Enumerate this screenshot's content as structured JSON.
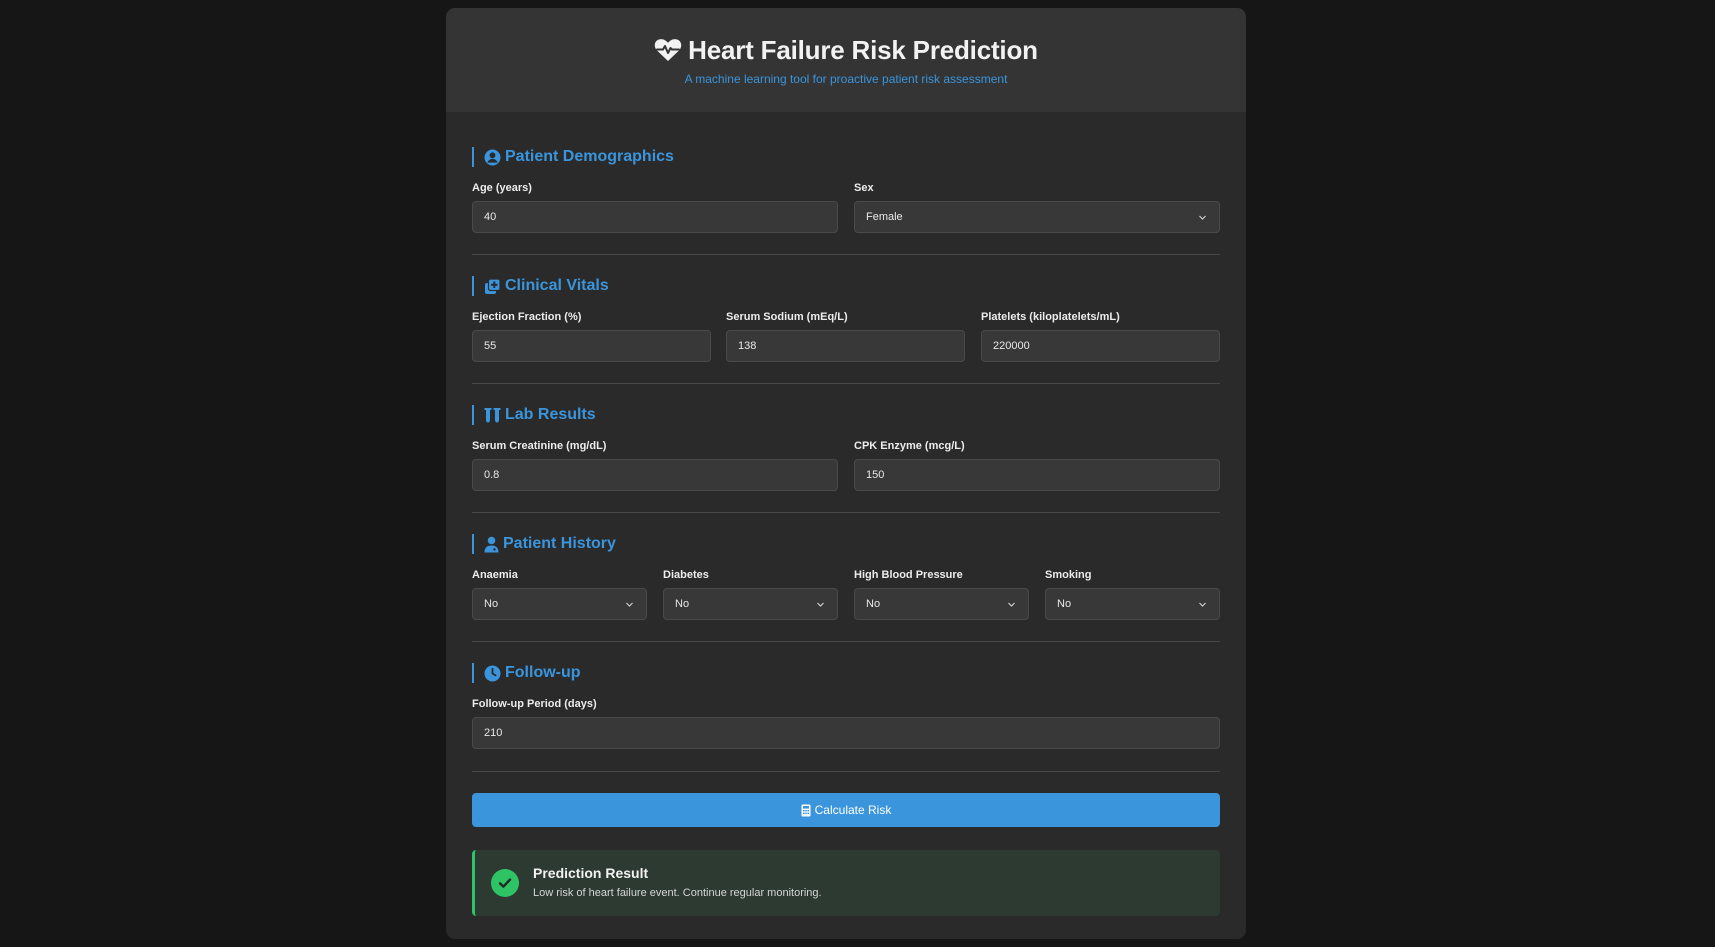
{
  "header": {
    "title": "Heart Failure Risk Prediction",
    "subtitle": "A machine learning tool for proactive patient risk assessment"
  },
  "sections": {
    "demographics": {
      "title": "Patient Demographics",
      "age_label": "Age (years)",
      "age_value": "40",
      "sex_label": "Sex",
      "sex_value": "Female"
    },
    "vitals": {
      "title": "Clinical Vitals",
      "ef_label": "Ejection Fraction (%)",
      "ef_value": "55",
      "sodium_label": "Serum Sodium (mEq/L)",
      "sodium_value": "138",
      "platelets_label": "Platelets (kiloplatelets/mL)",
      "platelets_value": "220000"
    },
    "labs": {
      "title": "Lab Results",
      "creatinine_label": "Serum Creatinine (mg/dL)",
      "creatinine_value": "0.8",
      "cpk_label": "CPK Enzyme (mcg/L)",
      "cpk_value": "150"
    },
    "history": {
      "title": "Patient History",
      "anaemia_label": "Anaemia",
      "anaemia_value": "No",
      "diabetes_label": "Diabetes",
      "diabetes_value": "No",
      "hbp_label": "High Blood Pressure",
      "hbp_value": "No",
      "smoking_label": "Smoking",
      "smoking_value": "No"
    },
    "followup": {
      "title": "Follow-up",
      "period_label": "Follow-up Period (days)",
      "period_value": "210"
    }
  },
  "actions": {
    "calculate_label": "Calculate Risk"
  },
  "result": {
    "title": "Prediction Result",
    "message": "Low risk of heart failure event. Continue regular monitoring."
  },
  "icons": {
    "title": "heart-pulse-icon",
    "demographics": "user-circle-icon",
    "vitals": "notes-medical-icon",
    "labs": "vials-icon",
    "history": "user-doctor-icon",
    "followup": "clock-icon",
    "calculate": "calculator-icon",
    "result": "check-circle-icon"
  },
  "colors": {
    "accent": "#3a95dc",
    "success": "#2ec466",
    "background": "#161616",
    "card": "#2a2a2a"
  }
}
